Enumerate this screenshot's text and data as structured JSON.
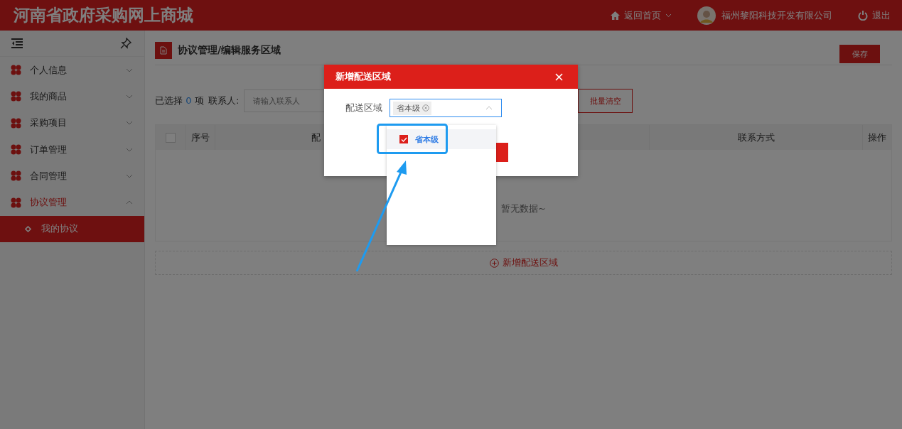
{
  "header": {
    "title": "河南省政府采购网上商城",
    "home_link": "返回首页",
    "user_name": "福州黎阳科技开发有限公司",
    "logout": "退出"
  },
  "sidebar": {
    "items": [
      {
        "label": "个人信息",
        "selected": false,
        "expanded": false
      },
      {
        "label": "我的商品",
        "selected": false,
        "expanded": false
      },
      {
        "label": "采购项目",
        "selected": false,
        "expanded": false
      },
      {
        "label": "订单管理",
        "selected": false,
        "expanded": false
      },
      {
        "label": "合同管理",
        "selected": false,
        "expanded": false
      },
      {
        "label": "协议管理",
        "selected": true,
        "expanded": true,
        "children": [
          {
            "label": "我的协议",
            "selected": true
          }
        ]
      }
    ]
  },
  "breadcrumb": "协议管理/编辑服务区域",
  "save_button": "保存",
  "toolbar": {
    "selected_prefix": "已选择",
    "selected_count": "0",
    "selected_suffix": "项",
    "contact_label": "联系人:",
    "contact_placeholder": "请输入联系人",
    "clear_button": "批量清空"
  },
  "table": {
    "select_all_checked": false,
    "columns": [
      {
        "label": "序号"
      },
      {
        "label": "配"
      },
      {
        "label": "联系方式"
      },
      {
        "label": "操作"
      }
    ],
    "empty_text": "暂无数据~",
    "add_button": "新增配送区域"
  },
  "dialog": {
    "title": "新增配送区域",
    "field_label": "配送区域",
    "tags": [
      "省本级"
    ],
    "options": [
      {
        "label": "省本级",
        "checked": true
      }
    ]
  }
}
